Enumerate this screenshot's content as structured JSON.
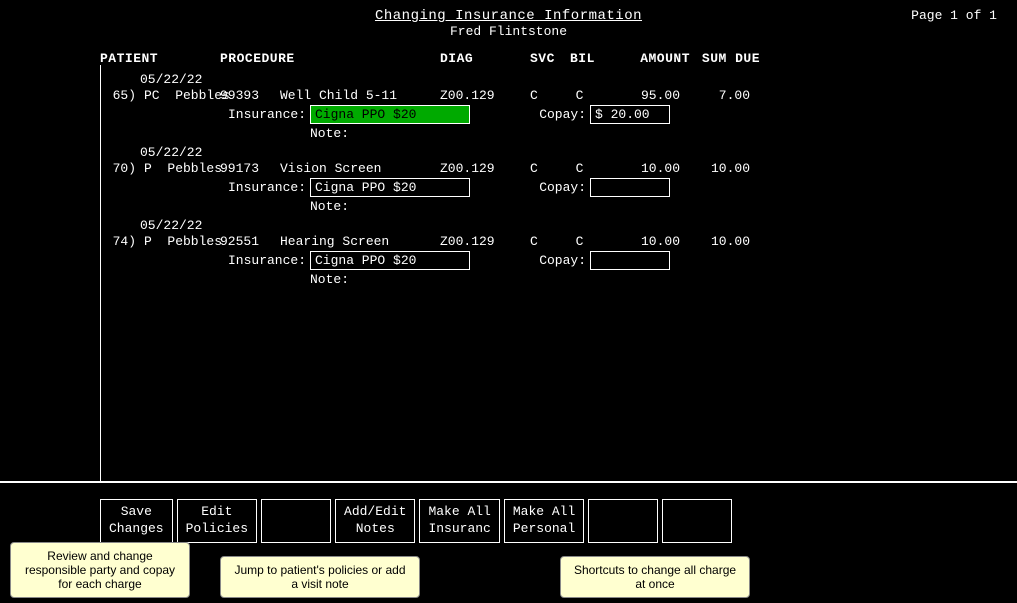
{
  "header": {
    "title": "Changing Insurance Information",
    "subtitle": "Fred Flintstone",
    "page": "Page 1 of 1"
  },
  "columns": {
    "patient": "PATIENT",
    "procedure": "PROCEDURE",
    "diag": "DIAG",
    "svc": "SVC",
    "bil": "BIL",
    "amount": "AMOUNT",
    "sumdue": "SUM DUE"
  },
  "charges": [
    {
      "date": "05/22/22",
      "num": "65)",
      "patient_prefix": "PC",
      "patient": "Pebbles",
      "code": "99393",
      "desc": "Well Child 5-11",
      "diag": "Z00.129",
      "svc": "C",
      "bil": "C",
      "amount": "95.00",
      "sumdue": "7.00",
      "insurance": "Cigna PPO $20",
      "insurance_active": true,
      "copay": "$ 20.00",
      "copay_dollar": true,
      "note": ""
    },
    {
      "date": "05/22/22",
      "num": "70)",
      "patient_prefix": "P",
      "patient": "Pebbles",
      "code": "99173",
      "desc": "Vision Screen",
      "diag": "Z00.129",
      "svc": "C",
      "bil": "C",
      "amount": "10.00",
      "sumdue": "10.00",
      "insurance": "Cigna PPO $20",
      "insurance_active": false,
      "copay": "",
      "copay_dollar": false,
      "note": ""
    },
    {
      "date": "05/22/22",
      "num": "74)",
      "patient_prefix": "P",
      "patient": "Pebbles",
      "code": "92551",
      "desc": "Hearing Screen",
      "diag": "Z00.129",
      "svc": "C",
      "bil": "C",
      "amount": "10.00",
      "sumdue": "10.00",
      "insurance": "Cigna PPO $20",
      "insurance_active": false,
      "copay": "",
      "copay_dollar": false,
      "note": ""
    }
  ],
  "buttons": [
    {
      "id": "save-changes",
      "line1": "Save",
      "line2": "Changes"
    },
    {
      "id": "edit-policies",
      "line1": "Edit",
      "line2": "Policies"
    },
    {
      "id": "empty-1",
      "line1": "",
      "line2": ""
    },
    {
      "id": "add-edit-notes",
      "line1": "Add/Edit",
      "line2": "Notes"
    },
    {
      "id": "make-all-insurance",
      "line1": "Make All",
      "line2": "Insuranc"
    },
    {
      "id": "make-all-personal",
      "line1": "Make All",
      "line2": "Personal"
    },
    {
      "id": "empty-2",
      "line1": "",
      "line2": ""
    },
    {
      "id": "empty-3",
      "line1": "",
      "line2": ""
    }
  ],
  "tooltips": {
    "left": {
      "text": "Review and change responsible party and copay for each charge"
    },
    "center": {
      "text": "Jump to patient's policies or add a visit note"
    },
    "right": {
      "text": "Shortcuts to change all charge at once"
    }
  }
}
